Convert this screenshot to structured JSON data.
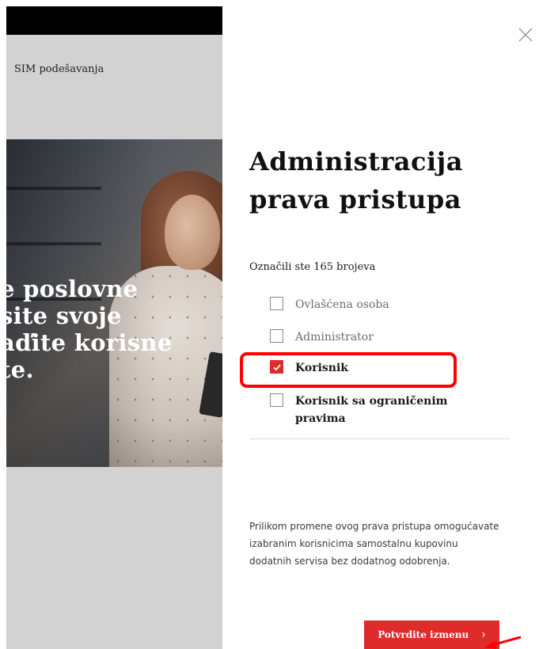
{
  "sidebar": {
    "sim_label": "SIM podešavanja",
    "hero_text": "e poslovne\nsite svoje\naďite korisne\nte."
  },
  "dialog": {
    "title": "Administracija prava pristupa",
    "selected_count_text": "Označili ste 165 brojeva",
    "options": [
      {
        "label": "Ovlašćena osoba",
        "checked": false
      },
      {
        "label": "Administrator",
        "checked": false
      },
      {
        "label": "Korisnik",
        "checked": true
      },
      {
        "label": "Korisnik sa ograničenim pravima",
        "checked": false
      }
    ],
    "info_text": "Prilikom promene ovog prava pristupa omogućavate izabranim korisnicima samostalnu kupovinu dodatnih servisa bez dodatnog odobrenja.",
    "confirm_label": "Potvrdite izmenu",
    "close_icon": "close-icon"
  },
  "colors": {
    "accent": "#e02b2b",
    "annotation": "#ff0000",
    "panel_bg": "#d2d2d2"
  }
}
